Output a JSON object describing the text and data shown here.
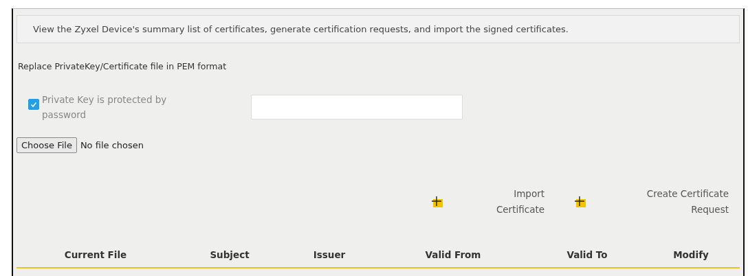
{
  "intro": "View the Zyxel Device's summary list of certificates, generate certification requests, and import the signed certificates.",
  "replace_title": "Replace PrivateKey/Certificate file in PEM format",
  "password_option": {
    "label": "Private Key is protected by password",
    "checked": true
  },
  "file_picker": {
    "button": "Choose File",
    "status": "No file chosen"
  },
  "actions": [
    {
      "label": "Import Certificate"
    },
    {
      "label": "Create Certificate Request"
    }
  ],
  "table": {
    "columns": [
      "Current File",
      "Subject",
      "Issuer",
      "Valid From",
      "Valid To",
      "Modify"
    ]
  }
}
